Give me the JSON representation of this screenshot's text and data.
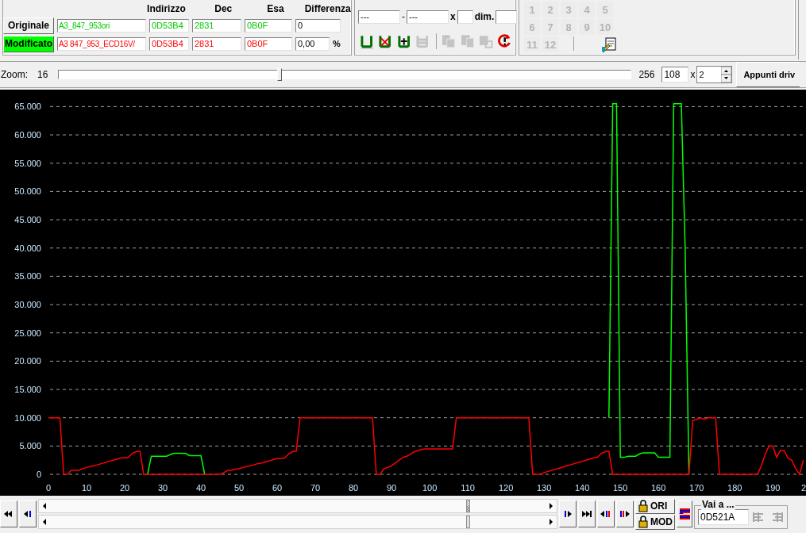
{
  "eprom": {
    "headers": [
      "Indirizzo",
      "Dec",
      "Esa",
      "Differenza"
    ],
    "rows": [
      {
        "label": "Originale",
        "selected": false,
        "color": "#00c800",
        "file": "A3_847_953ori",
        "address": "0D53B4",
        "dec": "2831",
        "hex": "0B0F",
        "diff": "0"
      },
      {
        "label": "Modificato",
        "selected": true,
        "color": "#ff0000",
        "file": "A3 847_953_ECD16V/",
        "address": "0D53B4",
        "dec": "2831",
        "hex": "0B0F",
        "diff": "0,00",
        "unit": "%"
      }
    ]
  },
  "selection": {
    "from": "---",
    "dash": "-",
    "to": "---",
    "x_label": "x",
    "dim_label": "dim.",
    "tools": [
      {
        "kind": "bars",
        "disabled": false
      },
      {
        "kind": "cross",
        "disabled": false
      },
      {
        "kind": "plus",
        "disabled": false
      },
      {
        "kind": "save",
        "disabled": true
      },
      {
        "kind": "copy",
        "disabled": true
      },
      {
        "kind": "copy2",
        "disabled": true
      },
      {
        "kind": "paste",
        "disabled": true
      },
      {
        "kind": "refresh",
        "disabled": false
      }
    ]
  },
  "slots": {
    "buttons": [
      {
        "label": "1",
        "disabled": true
      },
      {
        "label": "2",
        "disabled": true
      },
      {
        "label": "3",
        "disabled": true
      },
      {
        "label": "4",
        "disabled": true
      },
      {
        "label": "5",
        "disabled": true
      },
      {
        "label": "6",
        "disabled": true
      },
      {
        "label": "7",
        "disabled": true
      },
      {
        "label": "8",
        "disabled": true
      },
      {
        "label": "9",
        "disabled": true
      },
      {
        "label": "10",
        "disabled": true
      },
      {
        "label": "11",
        "disabled": true
      },
      {
        "label": "12",
        "disabled": true
      }
    ]
  },
  "zoom": {
    "label": "Zoom:",
    "min": "16",
    "max": "256",
    "level": 0.385,
    "value": "108",
    "x_label": "x",
    "factor": "2",
    "button": "Appunti driv"
  },
  "chart_data": {
    "type": "line",
    "grid": true,
    "xlim": [
      0,
      198.7
    ],
    "ylim": [
      0,
      68000
    ],
    "xticks": [
      0,
      10,
      20,
      30,
      40,
      50,
      60,
      70,
      80,
      90,
      100,
      110,
      120,
      130,
      140,
      150,
      160,
      170,
      180,
      190
    ],
    "yticks": [
      {
        "value": 0,
        "label": "0"
      },
      {
        "value": 5000,
        "label": "5.000"
      },
      {
        "value": 10000,
        "label": "10.000"
      },
      {
        "value": 15000,
        "label": "15.000"
      },
      {
        "value": 20000,
        "label": "20.000"
      },
      {
        "value": 25000,
        "label": "25.000"
      },
      {
        "value": 30000,
        "label": "30.000"
      },
      {
        "value": 35000,
        "label": "35.000"
      },
      {
        "value": 40000,
        "label": "40.000"
      },
      {
        "value": 45000,
        "label": "45.000"
      },
      {
        "value": 50000,
        "label": "50.000"
      },
      {
        "value": 55000,
        "label": "55.000"
      },
      {
        "value": 60000,
        "label": "60.000"
      },
      {
        "value": 65000,
        "label": "65.000"
      }
    ],
    "x": [
      0,
      1,
      2,
      3,
      4,
      5,
      6,
      7,
      8,
      9,
      10,
      11,
      12,
      13,
      14,
      15,
      16,
      17,
      18,
      19,
      20,
      21,
      22,
      23,
      24,
      25,
      26,
      27,
      28,
      29,
      30,
      31,
      32,
      33,
      34,
      35,
      36,
      37,
      38,
      39,
      40,
      41,
      42,
      43,
      44,
      45,
      46,
      47,
      48,
      49,
      50,
      51,
      52,
      53,
      54,
      55,
      56,
      57,
      58,
      59,
      60,
      61,
      62,
      63,
      64,
      65,
      66,
      67,
      68,
      69,
      70,
      71,
      72,
      73,
      74,
      75,
      76,
      77,
      78,
      79,
      80,
      81,
      82,
      83,
      84,
      85,
      86,
      87,
      88,
      89,
      90,
      91,
      92,
      93,
      94,
      95,
      96,
      97,
      98,
      99,
      100,
      101,
      102,
      103,
      104,
      105,
      106,
      107,
      108,
      109,
      110,
      111,
      112,
      113,
      114,
      115,
      116,
      117,
      118,
      119,
      120,
      121,
      122,
      123,
      124,
      125,
      126,
      127,
      128,
      129,
      130,
      131,
      132,
      133,
      134,
      135,
      136,
      137,
      138,
      139,
      140,
      141,
      142,
      143,
      144,
      145,
      146,
      147,
      148,
      149,
      150,
      151,
      152,
      153,
      154,
      155,
      156,
      157,
      158,
      159,
      160,
      161,
      162,
      163,
      164,
      165,
      166,
      167,
      168,
      169,
      170,
      171,
      172,
      173,
      174,
      175,
      176,
      177,
      178,
      179,
      180,
      181,
      182,
      183,
      184,
      185,
      186,
      187,
      188,
      189,
      190,
      191,
      192,
      193,
      194,
      195,
      196,
      197,
      198
    ],
    "series": [
      {
        "color": "#00ff00",
        "values": [
          null,
          null,
          null,
          null,
          null,
          null,
          null,
          null,
          null,
          null,
          null,
          null,
          null,
          null,
          null,
          null,
          null,
          null,
          null,
          null,
          null,
          null,
          null,
          null,
          null,
          null,
          0,
          3200,
          3200,
          3200,
          3200,
          3200,
          3500,
          3700,
          3700,
          3700,
          3700,
          3300,
          3300,
          3300,
          3300,
          0,
          null,
          null,
          null,
          null,
          null,
          null,
          null,
          null,
          null,
          null,
          null,
          null,
          null,
          null,
          null,
          null,
          null,
          null,
          null,
          null,
          null,
          null,
          null,
          null,
          null,
          null,
          null,
          null,
          null,
          null,
          null,
          null,
          null,
          null,
          null,
          null,
          null,
          null,
          null,
          null,
          null,
          null,
          null,
          null,
          null,
          null,
          null,
          null,
          null,
          null,
          null,
          null,
          null,
          null,
          null,
          null,
          null,
          null,
          null,
          null,
          null,
          null,
          null,
          null,
          null,
          null,
          null,
          null,
          null,
          null,
          null,
          null,
          null,
          null,
          null,
          null,
          null,
          null,
          null,
          null,
          null,
          null,
          null,
          null,
          null,
          null,
          null,
          null,
          null,
          null,
          null,
          null,
          null,
          null,
          null,
          null,
          null,
          null,
          null,
          null,
          null,
          null,
          null,
          null,
          null,
          10000,
          65500,
          65500,
          3000,
          3000,
          3200,
          3200,
          3200,
          3600,
          3800,
          3800,
          3800,
          3800,
          3000,
          3000,
          3000,
          3000,
          65500,
          65500,
          65500,
          40000,
          0,
          null,
          null,
          null,
          null,
          null,
          null,
          null,
          null,
          null,
          null,
          null,
          null,
          null,
          null,
          null,
          null,
          null,
          null,
          null,
          null,
          null,
          null,
          null,
          null,
          null,
          null,
          null,
          null,
          null,
          null
        ]
      },
      {
        "color": "#ff0000",
        "values": [
          10000,
          10000,
          10000,
          10000,
          0,
          0,
          700,
          700,
          700,
          1000,
          1200,
          1400,
          1500,
          1700,
          1900,
          2100,
          2300,
          2500,
          2700,
          2900,
          2900,
          3000,
          3700,
          4000,
          4100,
          0,
          0,
          0,
          0,
          0,
          0,
          0,
          0,
          0,
          0,
          0,
          0,
          0,
          0,
          0,
          0,
          0,
          0,
          0,
          0,
          0,
          300,
          700,
          700,
          900,
          1000,
          1200,
          1400,
          1500,
          1700,
          1900,
          2000,
          2200,
          2400,
          2600,
          2800,
          2800,
          2900,
          3600,
          4000,
          4100,
          10000,
          10000,
          10000,
          10000,
          10000,
          10000,
          10000,
          10000,
          10000,
          10000,
          10000,
          10000,
          10000,
          10000,
          10000,
          10000,
          10000,
          10000,
          10000,
          10000,
          0,
          0,
          1000,
          1200,
          1500,
          2000,
          2500,
          3000,
          3200,
          3600,
          4000,
          4200,
          4400,
          4500,
          4500,
          4500,
          4500,
          4500,
          4500,
          4500,
          4500,
          10000,
          10000,
          10000,
          10000,
          10000,
          10000,
          10000,
          10000,
          10000,
          10000,
          10000,
          10000,
          10000,
          10000,
          10000,
          10000,
          10000,
          10000,
          10000,
          10000,
          0,
          0,
          0,
          300,
          500,
          700,
          900,
          1100,
          1300,
          1500,
          1700,
          1900,
          2100,
          2300,
          2500,
          2700,
          2900,
          3000,
          3700,
          4000,
          4100,
          0,
          0,
          0,
          0,
          0,
          0,
          0,
          0,
          0,
          0,
          0,
          0,
          0,
          0,
          0,
          0,
          0,
          0,
          0,
          0,
          0,
          9500,
          9700,
          10000,
          9700,
          10000,
          10000,
          10000,
          0,
          0,
          0,
          0,
          0,
          0,
          0,
          0,
          0,
          0,
          0,
          1500,
          3500,
          5000,
          5000,
          3000,
          4200,
          4200,
          2800,
          2500,
          1000,
          0,
          2500
        ]
      }
    ]
  },
  "chart_edge_label": "2",
  "navigation": {
    "left_buttons": [
      {
        "kind": "first"
      },
      {
        "kind": "prev-diff"
      }
    ],
    "right_buttons": [
      {
        "kind": "next-diff"
      },
      {
        "kind": "last"
      },
      {
        "kind": "prev-both"
      },
      {
        "kind": "next-both"
      }
    ],
    "locks": [
      {
        "label": "ORI"
      },
      {
        "label": "MOD"
      }
    ],
    "goto": {
      "label": "Vai a ...",
      "value": "0D521A"
    }
  }
}
